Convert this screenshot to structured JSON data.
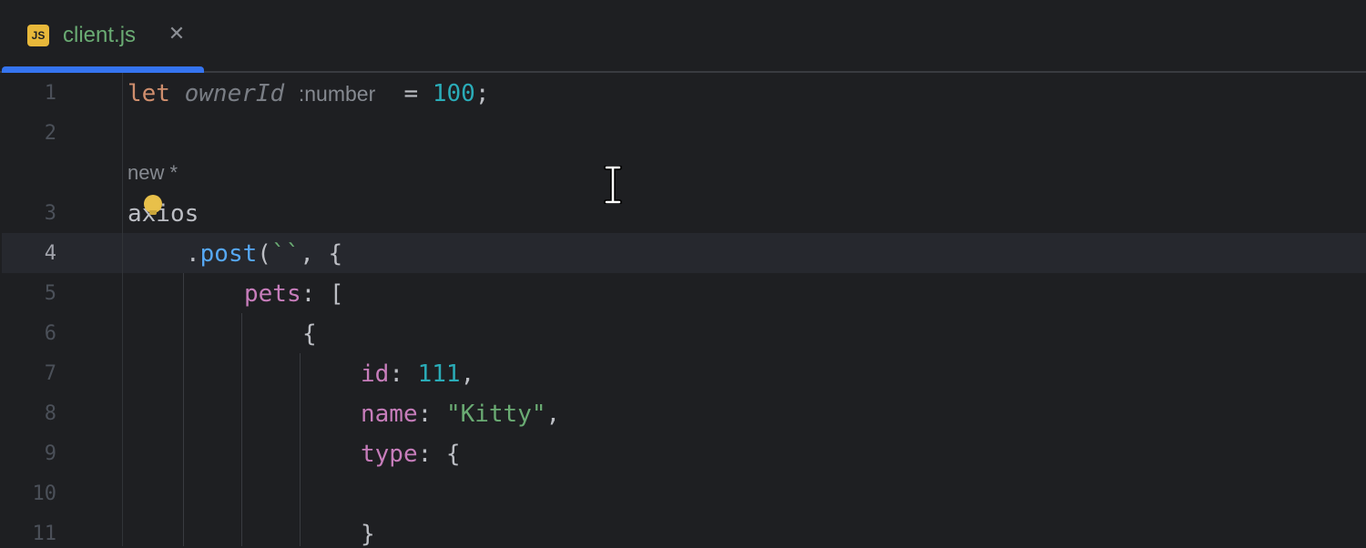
{
  "tab": {
    "icon": "JS",
    "title": "client.js",
    "close": "✕"
  },
  "lines": [
    "1",
    "2",
    "3",
    "4",
    "5",
    "6",
    "7",
    "8",
    "9",
    "10",
    "11"
  ],
  "code": {
    "l1": {
      "kw": "let",
      "var": "ownerId",
      "hint": ":number",
      "eq": " = ",
      "num": "100",
      "semi": ";"
    },
    "author": "new *",
    "l3": "axios",
    "l4": {
      "dot": ".",
      "fn": "post",
      "open": "(",
      "tpl": "``",
      "rest": ", {"
    },
    "l5": {
      "prop": "pets",
      "rest": ": ["
    },
    "l6": "{",
    "l7": {
      "prop": "id",
      "colon": ": ",
      "num": "111",
      "comma": ","
    },
    "l8": {
      "prop": "name",
      "colon": ": ",
      "str": "\"Kitty\"",
      "comma": ","
    },
    "l9": {
      "prop": "type",
      "rest": ": {"
    },
    "l11": "}"
  },
  "colors": {
    "accent": "#3574f0",
    "keyword": "#cf8e6d",
    "number": "#2aacb8",
    "string": "#6aab73",
    "property": "#c77dbb",
    "function": "#56a8f5"
  },
  "icons": [
    "js-file-icon",
    "close-icon",
    "lightbulb-icon",
    "text-cursor-icon"
  ]
}
